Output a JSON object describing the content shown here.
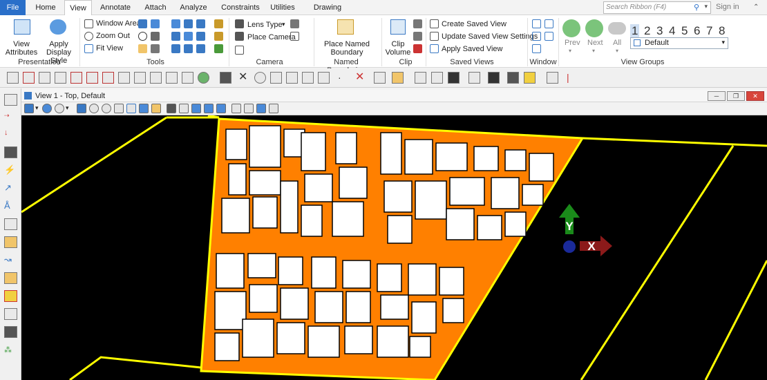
{
  "menu": {
    "tabs": [
      "File",
      "Home",
      "View",
      "Annotate",
      "Attach",
      "Analyze",
      "Constraints",
      "Utilities",
      "Drawing Aids"
    ],
    "search_placeholder": "Search Ribbon (F4)",
    "sign_in": "Sign in"
  },
  "ribbon": {
    "presentation": {
      "label": "Presentation",
      "view_attributes": "View Attributes",
      "apply_display_style": "Apply Display Style"
    },
    "tools": {
      "label": "Tools",
      "window_area": "Window Area",
      "zoom_out": "Zoom Out",
      "fit_view": "Fit View"
    },
    "camera": {
      "label": "Camera",
      "lens_type": "Lens Type",
      "place_camera": "Place Camera"
    },
    "named_boundaries": {
      "label": "Named Boundaries",
      "place_named_boundary": "Place Named Boundary"
    },
    "clip": {
      "label": "Clip",
      "clip_volume": "Clip Volume"
    },
    "saved_views": {
      "label": "Saved Views",
      "create": "Create Saved View",
      "update": "Update Saved View Settings",
      "apply": "Apply Saved View"
    },
    "window": {
      "label": "Window"
    },
    "view_groups": {
      "label": "View Groups",
      "prev": "Prev",
      "next": "Next",
      "all": "All",
      "numbers": [
        "1",
        "2",
        "3",
        "4",
        "5",
        "6",
        "7",
        "8"
      ],
      "selected_group": "Default"
    }
  },
  "view": {
    "title": "View 1 - Top, Default",
    "axis_y": "Y",
    "axis_x": "X"
  },
  "colors": {
    "accent": "#2a6fc9",
    "parcel_fill": "#ff8000",
    "boundary_line": "#ffff00",
    "background": "#000000",
    "axis_y": "#1a8a1a",
    "axis_x": "#8b1a1a"
  }
}
